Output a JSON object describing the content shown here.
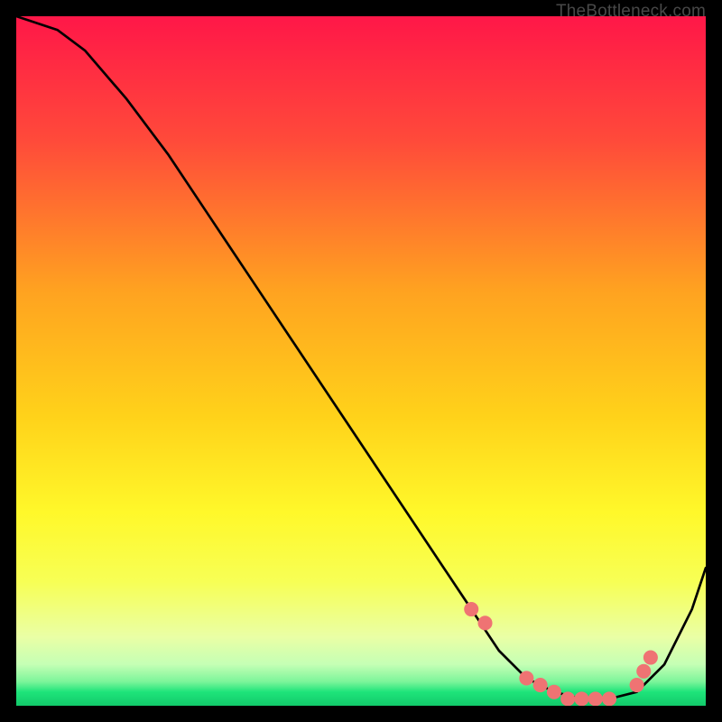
{
  "watermark": "TheBottleneck.com",
  "chart_data": {
    "type": "line",
    "title": "",
    "xlabel": "",
    "ylabel": "",
    "xlim": [
      0,
      100
    ],
    "ylim": [
      0,
      100
    ],
    "series": [
      {
        "name": "curve",
        "x": [
          0,
          6,
          10,
          16,
          22,
          28,
          34,
          40,
          46,
          52,
          58,
          62,
          66,
          70,
          74,
          78,
          82,
          86,
          90,
          94,
          98,
          100
        ],
        "values": [
          100,
          98,
          95,
          88,
          80,
          71,
          62,
          53,
          44,
          35,
          26,
          20,
          14,
          8,
          4,
          2,
          1,
          1,
          2,
          6,
          14,
          20
        ]
      }
    ],
    "markers": {
      "name": "highlight-dots",
      "color": "#ef7373",
      "x": [
        66,
        68,
        74,
        76,
        78,
        80,
        82,
        84,
        86,
        90,
        91,
        92
      ],
      "values": [
        14,
        12,
        4,
        3,
        2,
        1,
        1,
        1,
        1,
        3,
        5,
        7
      ]
    },
    "background_gradient": {
      "top": "#ff1748",
      "upper_mid": "#ff7a2c",
      "mid": "#ffd21a",
      "lower_mid": "#f7ff3a",
      "pale": "#f1ffb0",
      "green": "#1ee47a",
      "bottom": "#12c96a"
    }
  }
}
